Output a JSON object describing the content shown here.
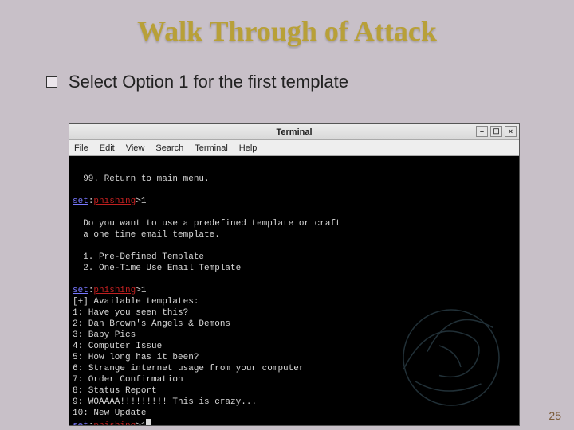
{
  "title": "Walk Through of Attack",
  "bullet": "Select Option 1 for the first template",
  "window": {
    "title": "Terminal",
    "controls": {
      "min": "–",
      "max": "☐",
      "close": "×"
    },
    "menu": [
      "File",
      "Edit",
      "View",
      "Search",
      "Terminal",
      "Help"
    ]
  },
  "term": {
    "return_line": "  99. Return to main menu.",
    "prompt_set": "set",
    "prompt_sep": ":",
    "prompt_ph": "phishing",
    "prompt_tail1": ">1",
    "ask1": "  Do you want to use a predefined template or craft",
    "ask2": "  a one time email template.",
    "opt1": "  1. Pre-Defined Template",
    "opt2": "  2. One-Time Use Email Template",
    "prompt_tail2": ">1",
    "avail": "[+] Available templates:",
    "t1": "1: Have you seen this?",
    "t2": "2: Dan Brown's Angels & Demons",
    "t3": "3: Baby Pics",
    "t4": "4: Computer Issue",
    "t5": "5: How long has it been?",
    "t6": "6: Strange internet usage from your computer",
    "t7": "7: Order Confirmation",
    "t8": "8: Status Report",
    "t9": "9: WOAAAA!!!!!!!!! This is crazy...",
    "t10": "10: New Update",
    "prompt_tail3": ">1"
  },
  "page_number": "25"
}
